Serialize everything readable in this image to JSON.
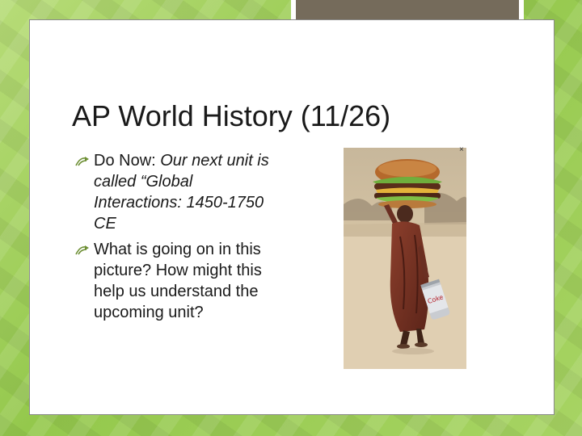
{
  "slide": {
    "title": "AP World History (11/26)",
    "bullets": [
      {
        "lead": "Do Now: ",
        "emphasis": "Our next unit is called “Global Interactions: 1450-1750 CE"
      },
      {
        "lead": "What is going on in this picture? How might this help us understand the upcoming unit?",
        "emphasis": ""
      }
    ]
  },
  "image": {
    "close_label": "×",
    "description_icon": "photo"
  },
  "colors": {
    "background": "#9ccc57",
    "accent_box": "#756b5b",
    "bullet_arrow": "#7a9a3a"
  }
}
